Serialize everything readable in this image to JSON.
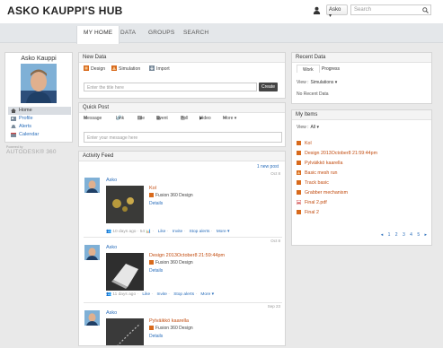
{
  "header": {
    "hub_title": "ASKO KAUPPI'S HUB",
    "user_menu_label": "Asko",
    "search_placeholder": "Search"
  },
  "nav": {
    "tabs": [
      {
        "label": "MY HOME"
      },
      {
        "label": "DATA"
      },
      {
        "label": "GROUPS"
      },
      {
        "label": "SEARCH"
      }
    ]
  },
  "profile": {
    "name": "Asko Kauppi",
    "menu": [
      {
        "label": "Home",
        "icon": "home-icon"
      },
      {
        "label": "Profile",
        "icon": "profile-icon"
      },
      {
        "label": "Alerts",
        "icon": "alert-icon"
      },
      {
        "label": "Calendar",
        "icon": "calendar-icon"
      }
    ],
    "powered_by": "Powered by",
    "brand": "AUTODESK® 360"
  },
  "new_data": {
    "title": "New Data",
    "tabs": [
      {
        "label": "Design",
        "icon": "design-icon"
      },
      {
        "label": "Simulation",
        "icon": "simulation-icon"
      },
      {
        "label": "Import",
        "icon": "import-icon"
      }
    ],
    "input_placeholder": "Enter the title here",
    "create_label": "Create"
  },
  "quick_post": {
    "title": "Quick Post",
    "actions": [
      {
        "label": "Message",
        "icon": "message-icon"
      },
      {
        "label": "Link",
        "icon": "link-icon"
      },
      {
        "label": "File",
        "icon": "file-icon"
      },
      {
        "label": "Event",
        "icon": "event-icon"
      },
      {
        "label": "Poll",
        "icon": "poll-icon"
      },
      {
        "label": "Video",
        "icon": "video-icon"
      },
      {
        "label": "More ▾",
        "icon": "more-icon"
      }
    ],
    "message_placeholder": "Enter your message here"
  },
  "activity_feed": {
    "title": "Activity Feed",
    "new_post_label": "1 new post",
    "items": [
      {
        "date": "Oct 8",
        "user": "Asko",
        "item_name": "Kol",
        "project": "Fusion 360 Design",
        "details_label": "Details",
        "time": "10 days ago",
        "count": "54",
        "actions": [
          "Like",
          "Invite",
          "Stop alerts",
          "More ▾"
        ]
      },
      {
        "date": "Oct 8",
        "user": "Asko",
        "item_name": "Design 2013October8 21:59:44pm",
        "project": "Fusion 360 Design",
        "details_label": "Details",
        "time": "11 days ago",
        "actions": [
          "Like",
          "Invite",
          "Stop alerts",
          "More ▾"
        ]
      },
      {
        "date": "Sep 23",
        "user": "Asko",
        "item_name": "Pylväikkö kaarella",
        "project": "Fusion 360 Design",
        "details_label": "Details"
      }
    ]
  },
  "recent_data": {
    "title": "Recent Data",
    "tabs": [
      {
        "label": "Work"
      },
      {
        "label": "Progress"
      }
    ],
    "view_label": "View :",
    "view_value": "Simulations ▾",
    "empty_text": "No Recent Data"
  },
  "my_items": {
    "title": "My Items",
    "view_label": "View :",
    "view_value": "All ▾",
    "items": [
      {
        "label": "Kol",
        "icon": "design-icon"
      },
      {
        "label": "Design 2013October8 21:59:44pm",
        "icon": "design-icon"
      },
      {
        "label": "Pylväikkö kaarella",
        "icon": "design-icon"
      },
      {
        "label": "Basic mesh run",
        "icon": "simulation-icon"
      },
      {
        "label": "Track basic",
        "icon": "design-icon"
      },
      {
        "label": "Grabber mechanism",
        "icon": "design-icon"
      },
      {
        "label": "Final 2.pdf",
        "icon": "pdf-icon"
      },
      {
        "label": "Final 2",
        "icon": "design-icon"
      }
    ],
    "pager": [
      "◂",
      "1",
      "2",
      "3",
      "4",
      "5",
      "▸"
    ]
  },
  "colors": {
    "accent_link": "#2a6ebb",
    "item_orange": "#c24b0e",
    "page_bg": "#e9e9e9"
  }
}
